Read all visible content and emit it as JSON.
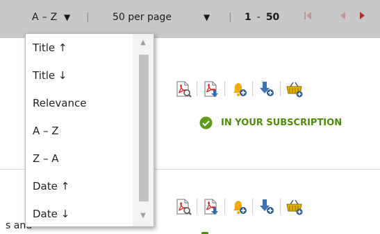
{
  "toolbar": {
    "sort_label": "A – Z",
    "sort_caret": "▼",
    "separator": "|",
    "per_page_label": "50 per page",
    "per_page_caret": "▼",
    "range_start": "1",
    "range_dash": "-",
    "range_end": "50",
    "first_page_icon": "first-page-icon",
    "prev_page_icon": "prev-page-icon",
    "next_page_icon": "next-page-icon"
  },
  "sort_dropdown": {
    "options": [
      {
        "label": "Title ↑"
      },
      {
        "label": "Title ↓"
      },
      {
        "label": "Relevance"
      },
      {
        "label": "A – Z"
      },
      {
        "label": "Z – A"
      },
      {
        "label": "Date ↑"
      },
      {
        "label": "Date ↓"
      }
    ],
    "scroll_up": "▲",
    "scroll_down": "▼"
  },
  "results": [
    {
      "icons": [
        "pdf-preview-icon",
        "pdf-download-icon",
        "add-alert-icon",
        "save-download-icon",
        "add-to-cart-icon"
      ],
      "status": "IN YOUR SUBSCRIPTION"
    },
    {
      "icons": [
        "pdf-preview-icon",
        "pdf-download-icon",
        "add-alert-icon",
        "save-download-icon",
        "add-to-cart-icon"
      ],
      "partial_text": "s and"
    }
  ],
  "colors": {
    "toolbar_bg": "#c8c8c8",
    "subscription_green": "#4f8c0b",
    "pager_active": "#b03030",
    "pager_disabled": "#c69595"
  }
}
